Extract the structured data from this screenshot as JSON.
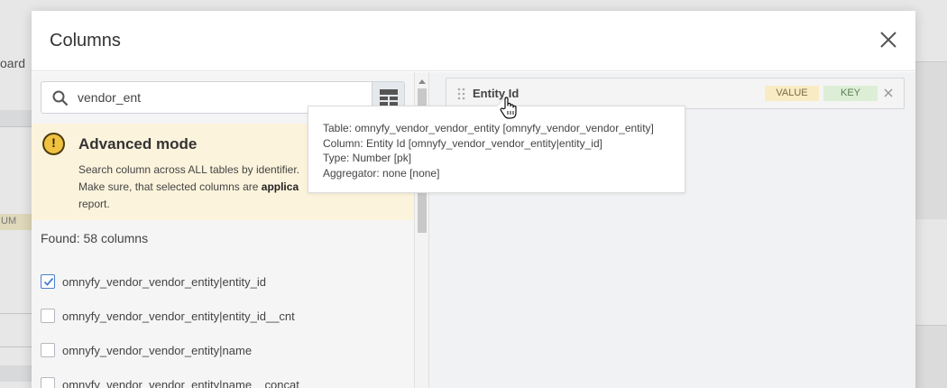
{
  "background": {
    "partial_text": "oard",
    "partial_badge": "UM"
  },
  "modal": {
    "title": "Columns",
    "close_icon": "close-icon"
  },
  "search": {
    "value": "vendor_ent",
    "icon": "search-icon",
    "toggle_icon": "grid-view-icon"
  },
  "advanced": {
    "icon": "warning-icon",
    "icon_mark": "!",
    "title": "Advanced mode",
    "line1": "Search column across ALL tables by identifier.",
    "line2_pre": "Make sure, that selected columns are ",
    "line2_bold": "applica",
    "line3": "report."
  },
  "found": "Found: 58 columns",
  "columns": [
    {
      "label": "omnyfy_vendor_vendor_entity|entity_id",
      "checked": true
    },
    {
      "label": "omnyfy_vendor_vendor_entity|entity_id__cnt",
      "checked": false
    },
    {
      "label": "omnyfy_vendor_vendor_entity|name",
      "checked": false
    },
    {
      "label": "omnyfy_vendor_vendor_entity|name__concat",
      "checked": false
    }
  ],
  "selected": {
    "name": "Entity Id",
    "tag_value": "VALUE",
    "tag_key": "KEY",
    "drag_icon": "drag-handle-icon",
    "remove_icon": "remove-icon"
  },
  "tooltip": {
    "table": "Table: omnyfy_vendor_vendor_entity [omnyfy_vendor_vendor_entity]",
    "column": "Column: Entity Id [omnyfy_vendor_vendor_entity|entity_id]",
    "type": "Type: Number [pk]",
    "aggregator": "Aggregator: none [none]"
  },
  "colors": {
    "accent": "#4a7fd0",
    "warning_bg": "#fcf3dc",
    "tag_value_bg": "#f9ecc4",
    "tag_key_bg": "#dcefd6"
  }
}
